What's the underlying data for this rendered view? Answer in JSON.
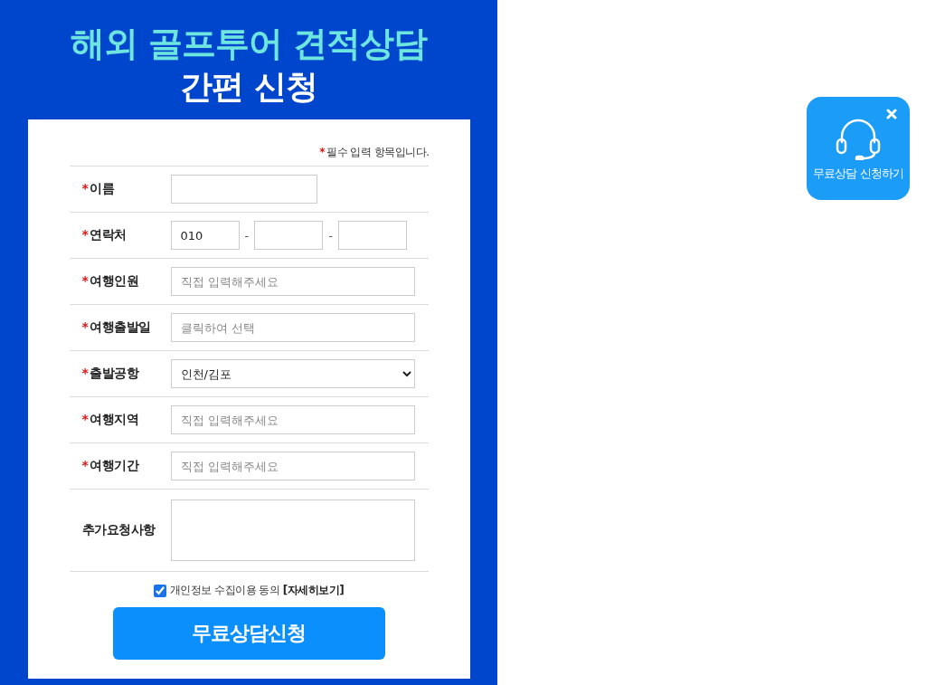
{
  "header": {
    "title": "해외 골프투어 견적상담",
    "subtitle": "간편 신청"
  },
  "required_mark": "*",
  "required_note": "필수 입력 항목입니다.",
  "fields": [
    {
      "kind": "text",
      "label": "이름",
      "required": true
    },
    {
      "kind": "phone",
      "label": "연락처",
      "required": true,
      "parts": [
        {
          "kind": "input",
          "value": "010"
        },
        {
          "kind": "input"
        },
        {
          "kind": "input"
        }
      ],
      "separator": "-"
    },
    {
      "kind": "text",
      "label": "여행인원",
      "required": true,
      "placeholder": "직접 입력해주세요"
    },
    {
      "kind": "text",
      "label": "여행출발일",
      "required": true,
      "placeholder": "클릭하여 선택"
    },
    {
      "kind": "select",
      "label": "출발공항",
      "required": true,
      "value": "인천/김포"
    },
    {
      "kind": "text",
      "label": "여행지역",
      "required": true,
      "placeholder": "직접 입력해주세요"
    },
    {
      "kind": "text",
      "label": "여행기간",
      "required": true,
      "placeholder": "직접 입력해주세요"
    },
    {
      "kind": "textarea",
      "label": "추가요청사항",
      "required": false
    }
  ],
  "consent": {
    "checked": true,
    "text": "개인정보 수집이용 동의",
    "link": "[자세히보기]"
  },
  "submit": "무료상담신청",
  "widget": {
    "label": "무료상담 신청하기"
  }
}
